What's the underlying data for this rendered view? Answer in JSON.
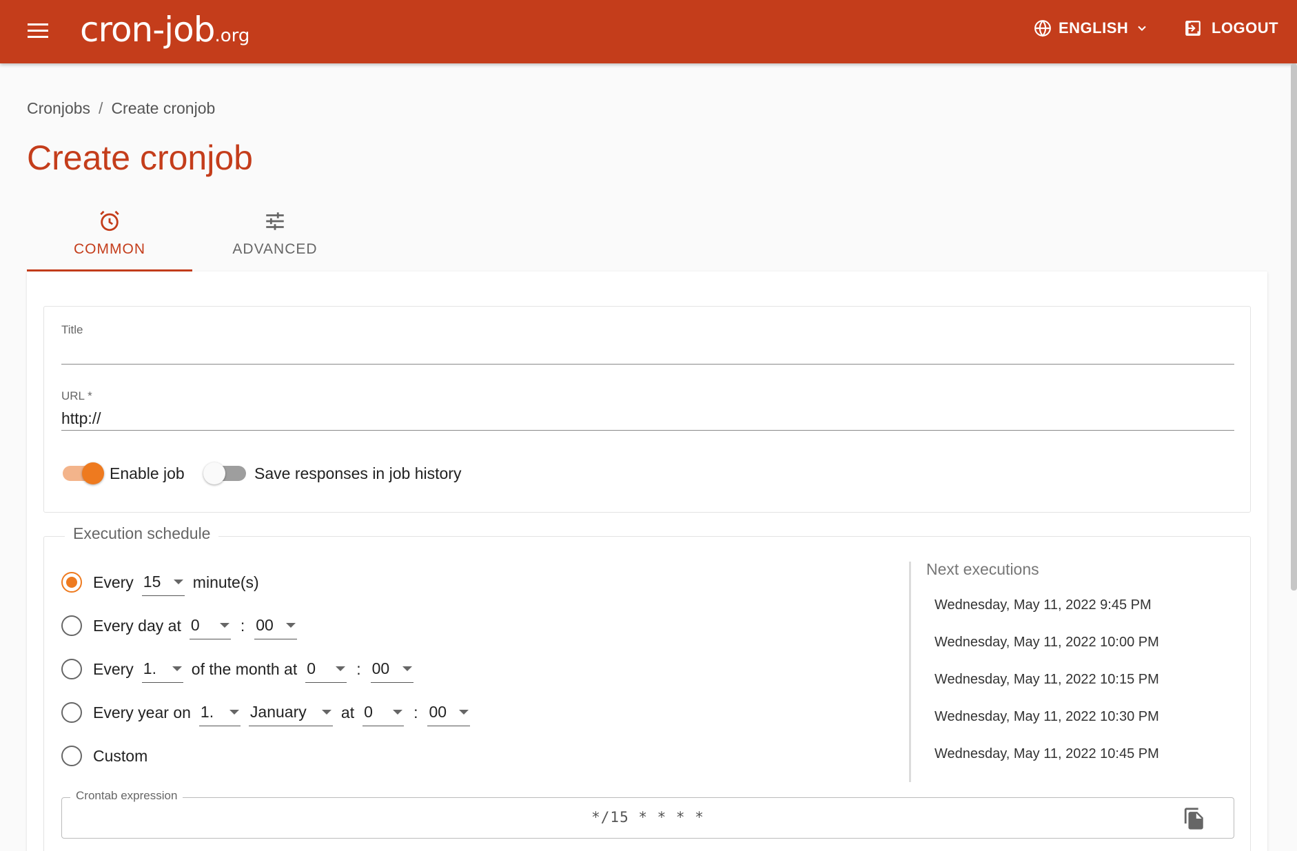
{
  "header": {
    "logo_main": "cron-job",
    "logo_suffix": ".org",
    "language": "ENGLISH",
    "logout": "LOGOUT"
  },
  "breadcrumb": [
    "Cronjobs",
    "Create cronjob"
  ],
  "page_title": "Create cronjob",
  "tabs": [
    {
      "label": "COMMON",
      "active": true,
      "icon": "alarm-icon"
    },
    {
      "label": "ADVANCED",
      "active": false,
      "icon": "tune-icon"
    }
  ],
  "form": {
    "title_label": "Title",
    "title_value": "",
    "url_label": "URL *",
    "url_value": "http://",
    "enable_job_label": "Enable job",
    "enable_job_on": true,
    "save_responses_label": "Save responses in job history",
    "save_responses_on": false
  },
  "schedule": {
    "legend": "Execution schedule",
    "every": {
      "prefix": "Every",
      "minutes": "15",
      "suffix": "minute(s)"
    },
    "daily": {
      "prefix": "Every day at",
      "hour": "0",
      "minute": "00"
    },
    "monthly": {
      "prefix": "Every",
      "day": "1.",
      "mid": "of the month at",
      "hour": "0",
      "minute": "00"
    },
    "yearly": {
      "prefix": "Every year on",
      "day": "1.",
      "month": "January",
      "mid": "at",
      "hour": "0",
      "minute": "00"
    },
    "custom": "Custom",
    "colon": ":",
    "next_title": "Next executions",
    "next_executions": [
      "Wednesday, May 11, 2022 9:45 PM",
      "Wednesday, May 11, 2022 10:00 PM",
      "Wednesday, May 11, 2022 10:15 PM",
      "Wednesday, May 11, 2022 10:30 PM",
      "Wednesday, May 11, 2022 10:45 PM"
    ],
    "crontab_label": "Crontab expression",
    "crontab_value": "*/15 * * * *"
  },
  "colors": {
    "brand": "#c43d1b",
    "accent": "#ee7a1f"
  }
}
